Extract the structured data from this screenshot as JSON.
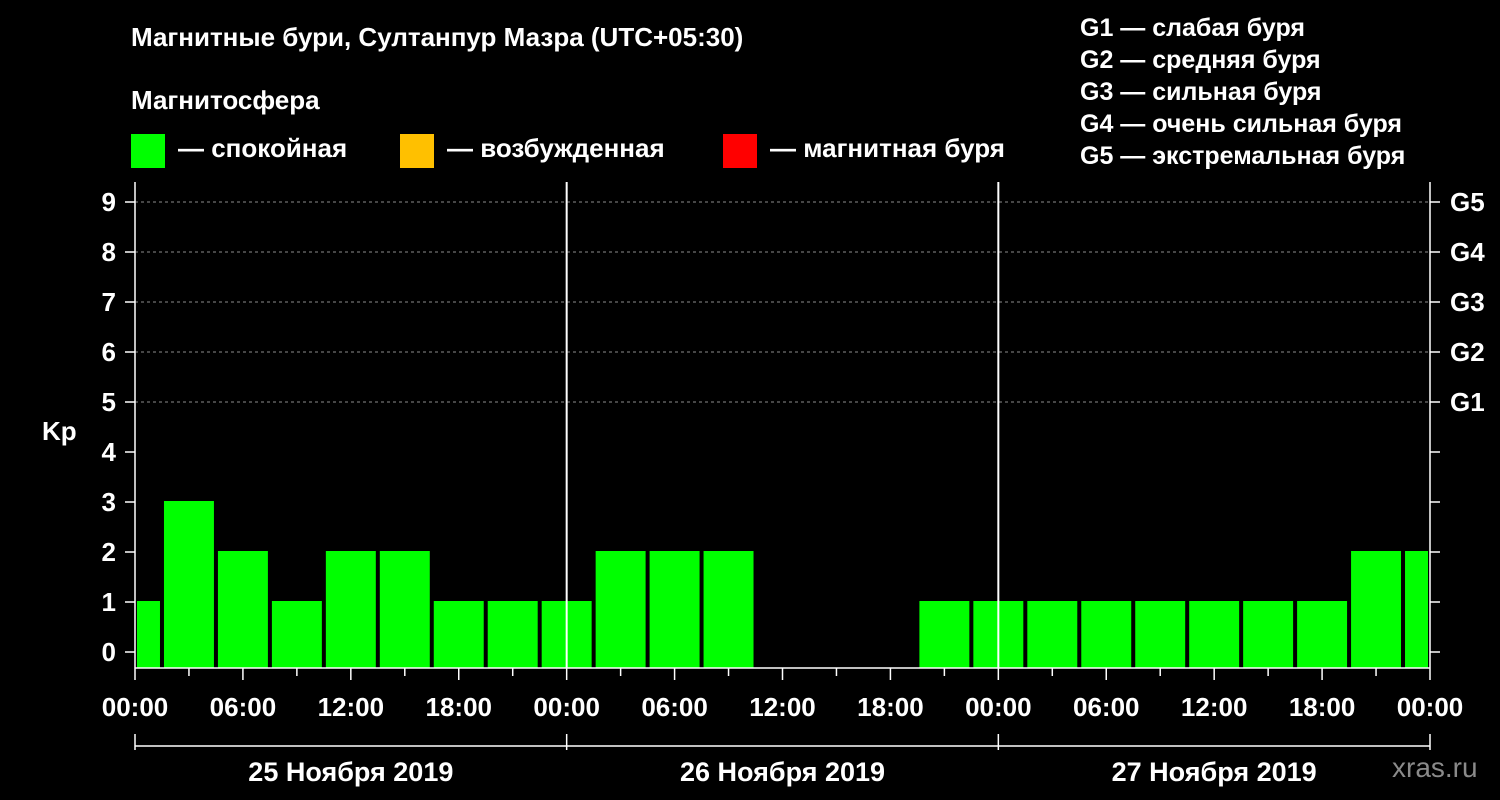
{
  "title": "Магнитные бури, Султанпур Мазра (UTC+05:30)",
  "legend": {
    "title": "Магнитосфера",
    "items": [
      {
        "label": "— спокойная",
        "color": "#00ff00"
      },
      {
        "label": "— возбужденная",
        "color": "#ffc000"
      },
      {
        "label": "— магнитная буря",
        "color": "#ff0000"
      }
    ]
  },
  "g_scale": [
    {
      "level": "G1",
      "label": "G1 — слабая буря"
    },
    {
      "level": "G2",
      "label": "G2 — средняя буря"
    },
    {
      "level": "G3",
      "label": "G3 — сильная буря"
    },
    {
      "level": "G4",
      "label": "G4 — очень сильная буря"
    },
    {
      "level": "G5",
      "label": "G5 — экстремальная буря"
    }
  ],
  "watermark": "xras.ru",
  "chart_data": {
    "type": "bar",
    "ylabel": "Kp",
    "ylim": [
      0,
      9
    ],
    "yticks": [
      0,
      1,
      2,
      3,
      4,
      5,
      6,
      7,
      8,
      9
    ],
    "right_ticks": [
      {
        "kp": 5,
        "label": "G1"
      },
      {
        "kp": 6,
        "label": "G2"
      },
      {
        "kp": 7,
        "label": "G3"
      },
      {
        "kp": 8,
        "label": "G4"
      },
      {
        "kp": 9,
        "label": "G5"
      }
    ],
    "grid_lines_kp": [
      5,
      6,
      7,
      8,
      9
    ],
    "xticks": [
      "00:00",
      "06:00",
      "12:00",
      "18:00",
      "00:00",
      "06:00",
      "12:00",
      "18:00",
      "00:00",
      "06:00",
      "12:00",
      "18:00",
      "00:00"
    ],
    "days": [
      "25 Ноября 2019",
      "26 Ноября 2019",
      "27 Ноября 2019"
    ],
    "bar_color": "#00ff00",
    "bars": [
      {
        "start_hour": 0,
        "end_hour": 1.5,
        "value": 1
      },
      {
        "start_hour": 1.5,
        "end_hour": 4.5,
        "value": 3
      },
      {
        "start_hour": 4.5,
        "end_hour": 7.5,
        "value": 2
      },
      {
        "start_hour": 7.5,
        "end_hour": 10.5,
        "value": 1
      },
      {
        "start_hour": 10.5,
        "end_hour": 13.5,
        "value": 2
      },
      {
        "start_hour": 13.5,
        "end_hour": 16.5,
        "value": 2
      },
      {
        "start_hour": 16.5,
        "end_hour": 19.5,
        "value": 1
      },
      {
        "start_hour": 19.5,
        "end_hour": 22.5,
        "value": 1
      },
      {
        "start_hour": 22.5,
        "end_hour": 25.5,
        "value": 1
      },
      {
        "start_hour": 25.5,
        "end_hour": 28.5,
        "value": 2
      },
      {
        "start_hour": 28.5,
        "end_hour": 31.5,
        "value": 2
      },
      {
        "start_hour": 31.5,
        "end_hour": 34.5,
        "value": 2
      },
      {
        "start_hour": 34.5,
        "end_hour": 37.5,
        "value": 0
      },
      {
        "start_hour": 37.5,
        "end_hour": 40.5,
        "value": 0
      },
      {
        "start_hour": 40.5,
        "end_hour": 43.5,
        "value": 0
      },
      {
        "start_hour": 43.5,
        "end_hour": 46.5,
        "value": 1
      },
      {
        "start_hour": 46.5,
        "end_hour": 49.5,
        "value": 1
      },
      {
        "start_hour": 49.5,
        "end_hour": 52.5,
        "value": 1
      },
      {
        "start_hour": 52.5,
        "end_hour": 55.5,
        "value": 1
      },
      {
        "start_hour": 55.5,
        "end_hour": 58.5,
        "value": 1
      },
      {
        "start_hour": 58.5,
        "end_hour": 61.5,
        "value": 1
      },
      {
        "start_hour": 61.5,
        "end_hour": 64.5,
        "value": 1
      },
      {
        "start_hour": 64.5,
        "end_hour": 67.5,
        "value": 1
      },
      {
        "start_hour": 67.5,
        "end_hour": 70.5,
        "value": 2
      },
      {
        "start_hour": 70.5,
        "end_hour": 72,
        "value": 2
      }
    ]
  }
}
